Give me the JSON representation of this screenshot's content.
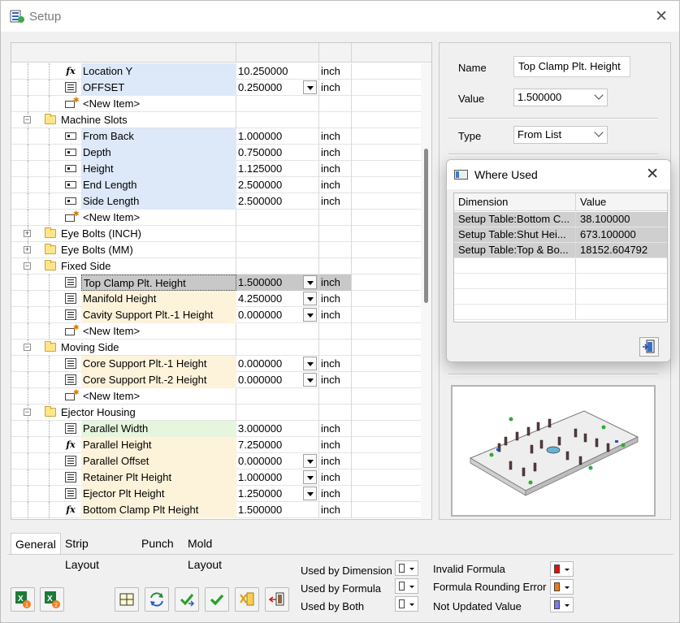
{
  "window": {
    "title": "Setup"
  },
  "grid": {
    "rows": [
      {
        "label": "Location Y",
        "value": "10.250000",
        "unit": "inch",
        "icon": "fx-icon"
      },
      {
        "label": "OFFSET",
        "value": "0.250000",
        "unit": "inch",
        "icon": "list-icon"
      },
      {
        "label": "<New Item>",
        "value": "",
        "unit": "",
        "icon": "new-item-icon"
      },
      {
        "label": "Machine Slots",
        "value": "",
        "unit": "",
        "icon": "folder-icon"
      },
      {
        "label": "From Back",
        "value": "1.000000",
        "unit": "inch",
        "icon": "field-icon"
      },
      {
        "label": "Depth",
        "value": "0.750000",
        "unit": "inch",
        "icon": "field-icon"
      },
      {
        "label": "Height",
        "value": "1.125000",
        "unit": "inch",
        "icon": "field-icon"
      },
      {
        "label": "End Length",
        "value": "2.500000",
        "unit": "inch",
        "icon": "field-icon"
      },
      {
        "label": "Side Length",
        "value": "2.500000",
        "unit": "inch",
        "icon": "field-icon"
      },
      {
        "label": "<New Item>",
        "value": "",
        "unit": "",
        "icon": "new-item-icon"
      },
      {
        "label": "Eye Bolts (INCH)",
        "value": "",
        "unit": "",
        "icon": "folder-icon"
      },
      {
        "label": "Eye Bolts (MM)",
        "value": "",
        "unit": "",
        "icon": "folder-icon"
      },
      {
        "label": "Fixed Side",
        "value": "",
        "unit": "",
        "icon": "folder-icon"
      },
      {
        "label": "Top Clamp Plt. Height",
        "value": "1.500000",
        "unit": "inch",
        "icon": "list-icon"
      },
      {
        "label": "Manifold Height",
        "value": "4.250000",
        "unit": "inch",
        "icon": "list-icon"
      },
      {
        "label": "Cavity Support Plt.-1  Height",
        "value": "0.000000",
        "unit": "inch",
        "icon": "list-icon"
      },
      {
        "label": "<New Item>",
        "value": "",
        "unit": "",
        "icon": "new-item-icon"
      },
      {
        "label": "Moving Side",
        "value": "",
        "unit": "",
        "icon": "folder-icon"
      },
      {
        "label": "Core Support Plt.-1  Height",
        "value": "0.000000",
        "unit": "inch",
        "icon": "list-icon"
      },
      {
        "label": "Core Support Plt.-2  Height",
        "value": "0.000000",
        "unit": "inch",
        "icon": "list-icon"
      },
      {
        "label": "<New Item>",
        "value": "",
        "unit": "",
        "icon": "new-item-icon"
      },
      {
        "label": "Ejector Housing",
        "value": "",
        "unit": "",
        "icon": "folder-icon"
      },
      {
        "label": "Parallel Width",
        "value": "3.000000",
        "unit": "inch",
        "icon": "list-icon"
      },
      {
        "label": "Parallel Height",
        "value": "7.250000",
        "unit": "inch",
        "icon": "fx-icon"
      },
      {
        "label": "Parallel Offset",
        "value": "0.000000",
        "unit": "inch",
        "icon": "list-icon"
      },
      {
        "label": "Retainer Plt Height",
        "value": "1.000000",
        "unit": "inch",
        "icon": "list-icon"
      },
      {
        "label": "Ejector Plt Height",
        "value": "1.250000",
        "unit": "inch",
        "icon": "list-icon"
      },
      {
        "label": "Bottom Clamp Plt Height",
        "value": "1.500000",
        "unit": "inch",
        "icon": "fx-icon"
      }
    ]
  },
  "details": {
    "name_label": "Name",
    "name_value": "Top Clamp Plt. Height",
    "value_label": "Value",
    "value_value": "1.500000",
    "type_label": "Type",
    "type_value": "From List"
  },
  "where_used": {
    "title": "Where Used",
    "col_dimension": "Dimension",
    "col_value": "Value",
    "rows": [
      {
        "dimension": "Setup Table:Bottom C...",
        "value": "38.100000"
      },
      {
        "dimension": "Setup Table:Shut Hei...",
        "value": "673.100000"
      },
      {
        "dimension": "Setup Table:Top & Bo...",
        "value": "18152.604792"
      }
    ]
  },
  "tabs": [
    "General",
    "Strip Layout",
    "Punch",
    "Mold Layout"
  ],
  "legend": {
    "used_by_dimension": "Used by Dimension",
    "used_by_formula": "Used by Formula",
    "used_by_both": "Used by Both",
    "invalid_formula": "Invalid Formula",
    "formula_rounding_error": "Formula Rounding Error",
    "not_updated_value": "Not Updated Value"
  },
  "colors": {
    "invalid_formula": "#e01010",
    "formula_rounding_error": "#f07a10",
    "not_updated_value": "#7a7af0",
    "row_blue": "#dde8f8",
    "row_yellow": "#fdf3db",
    "row_green": "#e6f6de"
  },
  "toolbar_icons": [
    "excel-import-1-icon",
    "excel-import-2-icon",
    "layout-icon",
    "refresh-icon",
    "check-green-arrow-icon",
    "check-icon",
    "delete-icon",
    "export-icon"
  ]
}
